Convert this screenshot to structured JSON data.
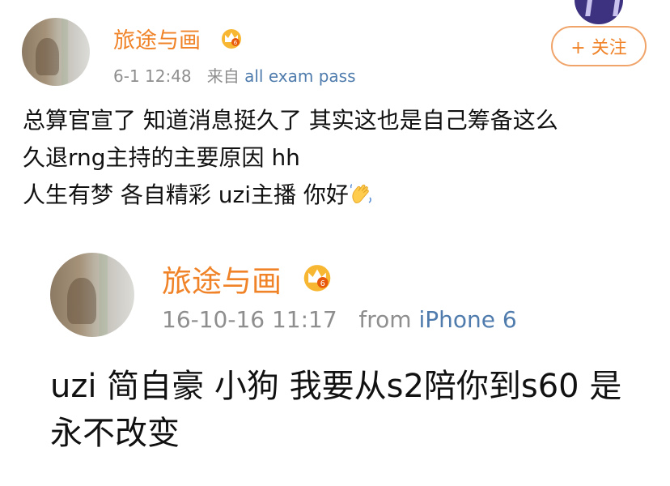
{
  "colors": {
    "username": "#f08328",
    "meta": "#8e8e8e",
    "source_link": "#4f7cad",
    "follow_border": "#f0a46a",
    "text": "#111111"
  },
  "post": {
    "username": "旅途与画",
    "vip_icon": "crown-icon",
    "timestamp": "6-1 12:48",
    "source_prefix": "来自",
    "source": "all exam pass",
    "follow_label": "+ 关注",
    "text_lines": [
      "总算官宣了 知道消息挺久了 其实这也是自己筹备这么",
      "久退rng主持的主要原因 hh",
      "人生有梦 各自精彩 uzi主播 你好"
    ],
    "emoji": "waving-hand-icon"
  },
  "quoted_post": {
    "username": "旅途与画",
    "vip_icon": "crown-icon",
    "timestamp": "16-10-16 11:17",
    "source_prefix": "from",
    "source": "iPhone 6",
    "text_lines": [
      "uzi 简自豪 小狗 我要从s2陪你到s60 是",
      "永不改变"
    ]
  }
}
